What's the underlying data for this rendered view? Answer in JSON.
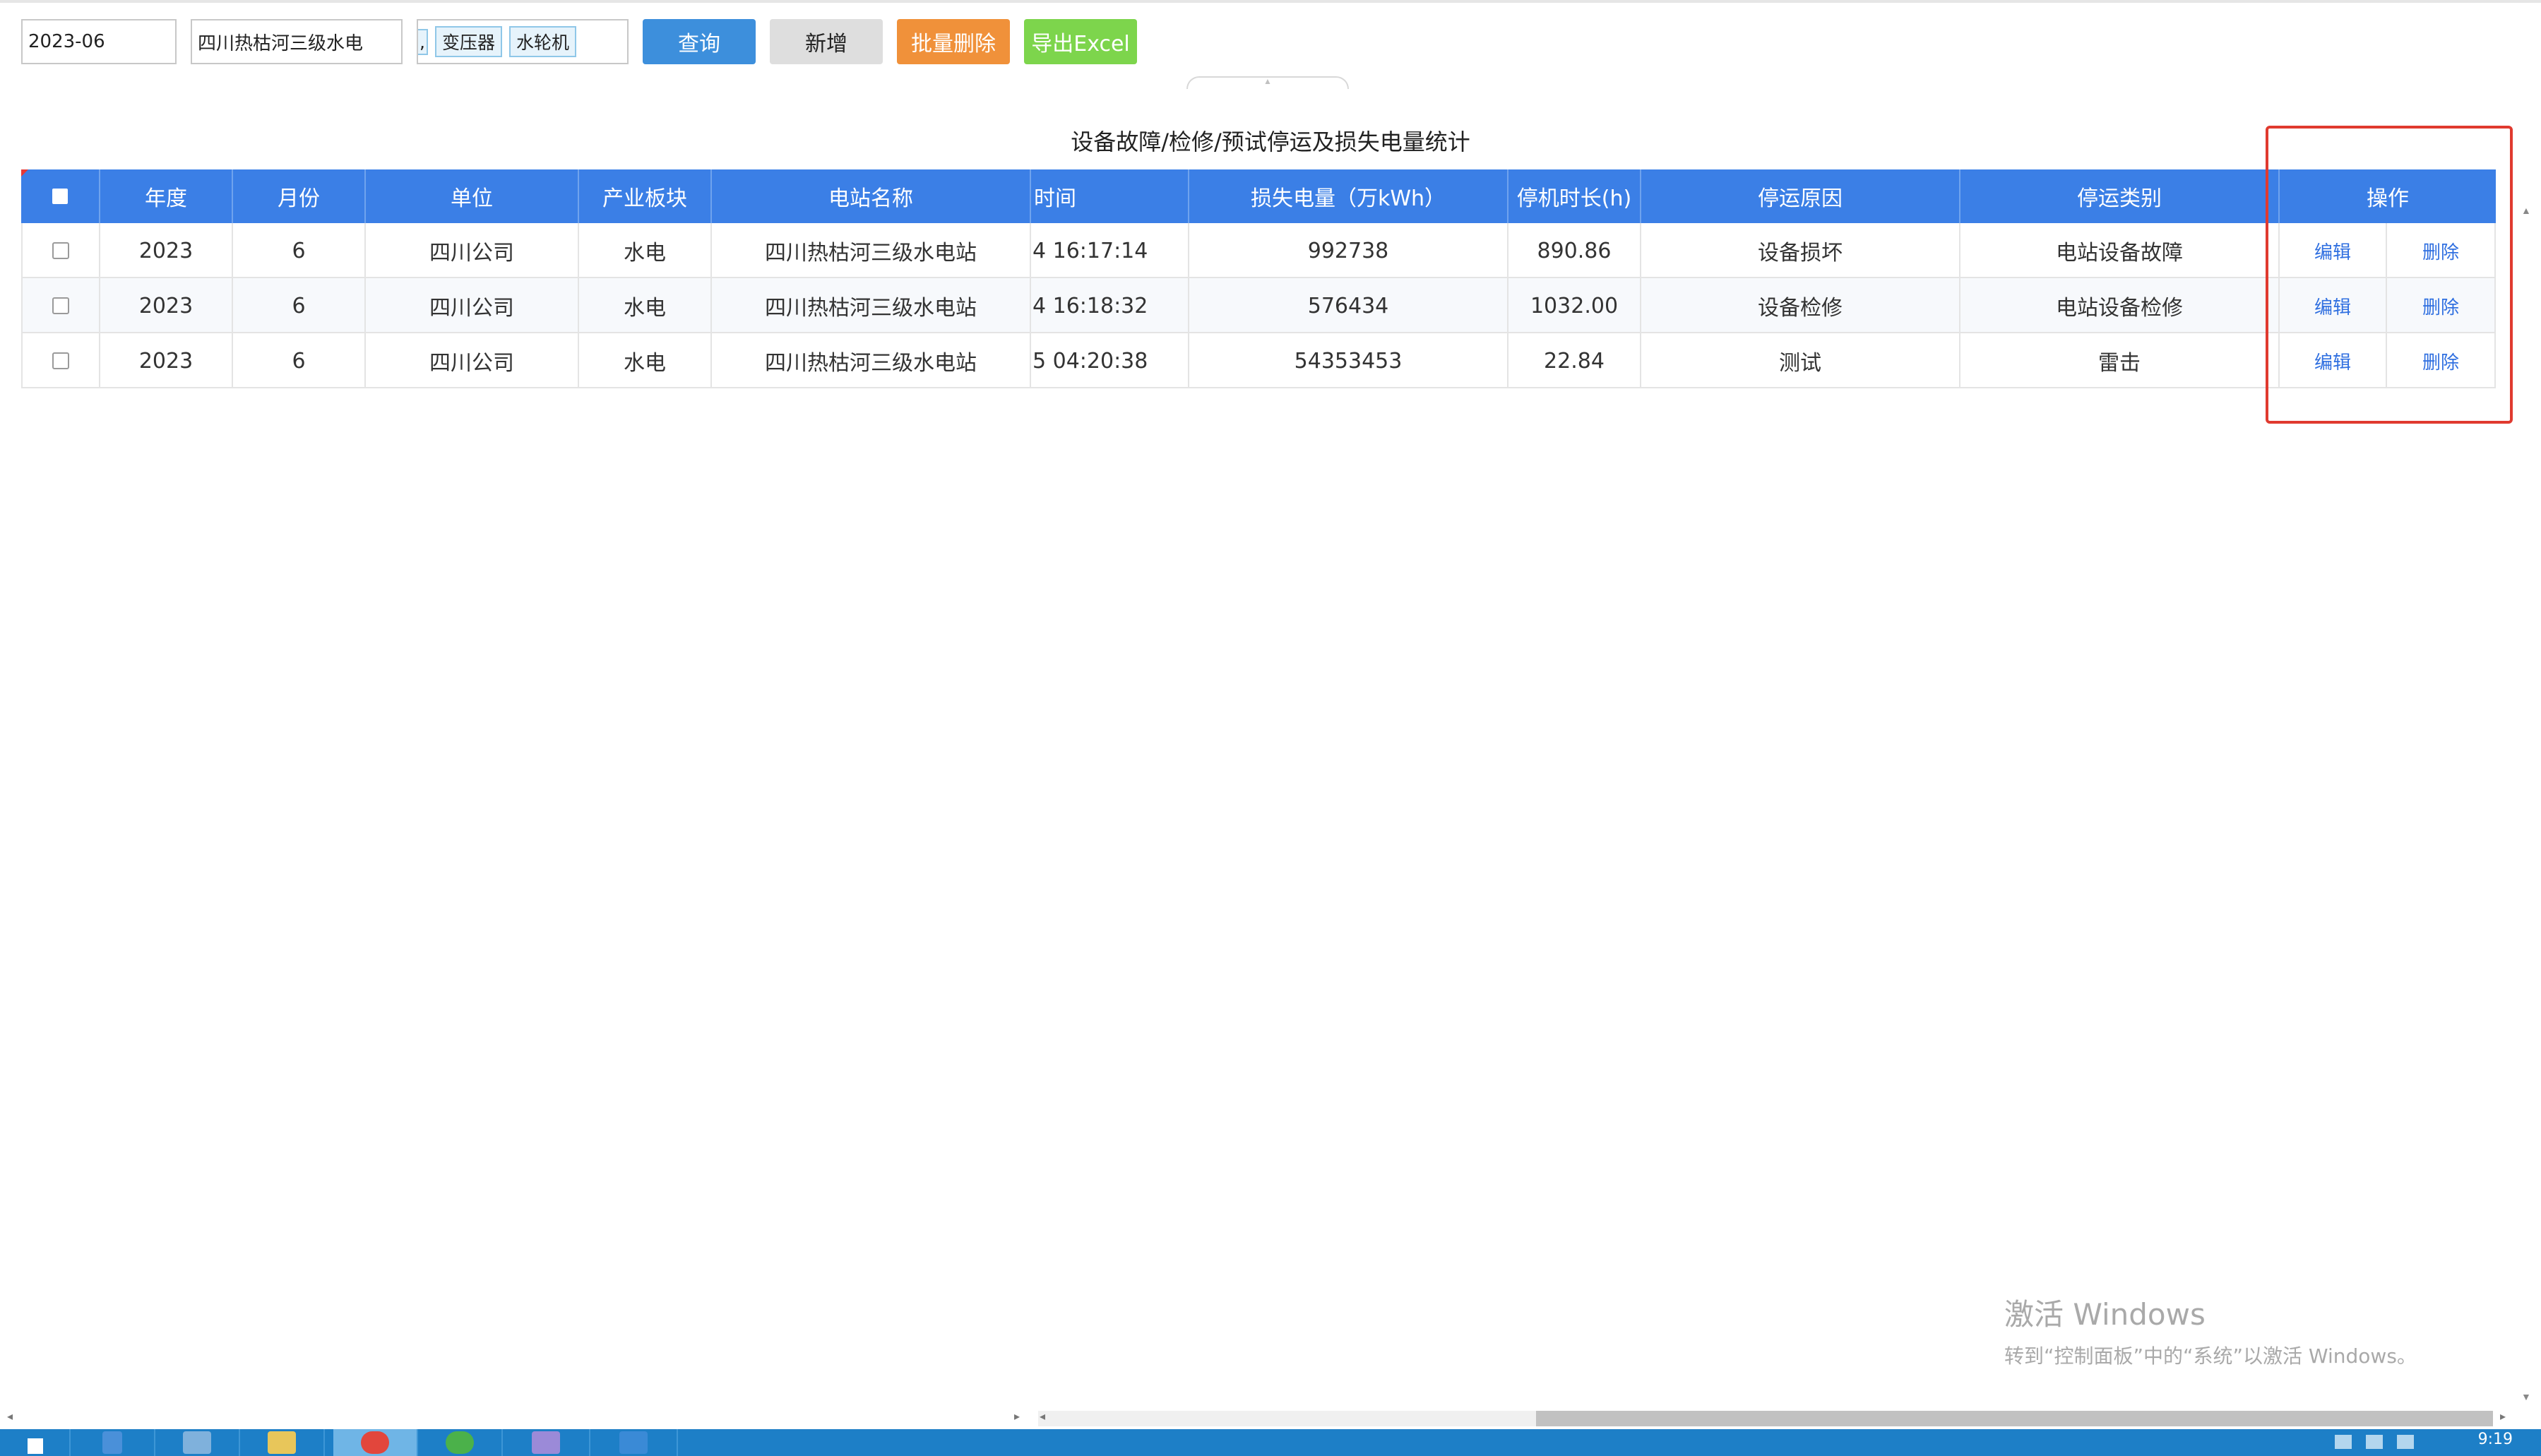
{
  "toolbar": {
    "month_value": "2023-06",
    "station_value": "四川热枯河三级水电",
    "tags_clipped": ",",
    "tags": [
      "变压器",
      "水轮机"
    ],
    "query_label": "查询",
    "add_label": "新增",
    "batch_delete_label": "批量删除",
    "export_label": "导出Excel"
  },
  "table": {
    "title": "设备故障/检修/预试停运及损失电量统计",
    "headers": {
      "year": "年度",
      "month": "月份",
      "unit": "单位",
      "sector": "产业板块",
      "station": "电站名称",
      "time": "时间",
      "loss": "损失电量（万kWh）",
      "downtime": "停机时长(h)",
      "reason": "停运原因",
      "category": "停运类别",
      "ops": "操作"
    },
    "edit_label": "编辑",
    "delete_label": "删除",
    "rows": [
      {
        "year": "2023",
        "month": "6",
        "unit": "四川公司",
        "sector": "水电",
        "station": "四川热枯河三级水电站",
        "time": "4 16:17:14",
        "loss": "992738",
        "downtime": "890.86",
        "reason": "设备损坏",
        "category": "电站设备故障"
      },
      {
        "year": "2023",
        "month": "6",
        "unit": "四川公司",
        "sector": "水电",
        "station": "四川热枯河三级水电站",
        "time": "4 16:18:32",
        "loss": "576434",
        "downtime": "1032.00",
        "reason": "设备检修",
        "category": "电站设备检修"
      },
      {
        "year": "2023",
        "month": "6",
        "unit": "四川公司",
        "sector": "水电",
        "station": "四川热枯河三级水电站",
        "time": "5 04:20:38",
        "loss": "54353453",
        "downtime": "22.84",
        "reason": "测试",
        "category": "雷击"
      }
    ]
  },
  "watermark": {
    "line1": "激活 Windows",
    "line2": "转到“控制面板”中的“系统”以激活 Windows。"
  },
  "taskbar": {
    "clock": "9:19"
  }
}
